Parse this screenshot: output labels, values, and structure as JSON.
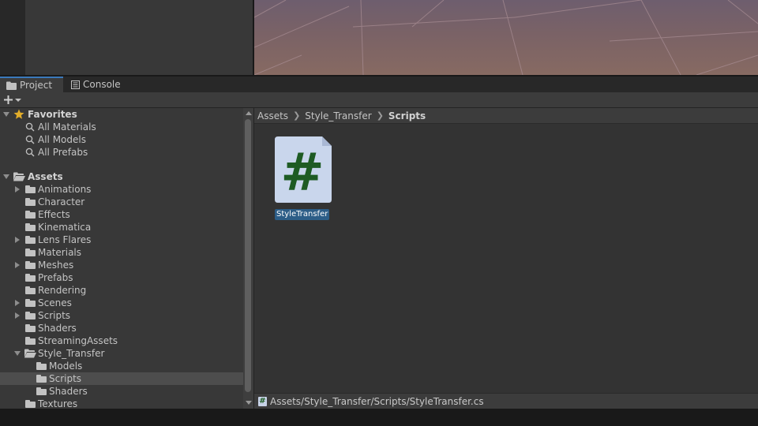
{
  "tabs": {
    "project": {
      "label": "Project",
      "icon": "folder-icon"
    },
    "console": {
      "label": "Console",
      "icon": "console-icon"
    }
  },
  "toolbar": {
    "create_icon": "plus-icon",
    "dropdown_icon": "chevron-down-icon"
  },
  "favorites": {
    "label": "Favorites",
    "items": [
      {
        "label": "All Materials",
        "icon": "search-icon"
      },
      {
        "label": "All Models",
        "icon": "search-icon"
      },
      {
        "label": "All Prefabs",
        "icon": "search-icon"
      }
    ]
  },
  "assets": {
    "label": "Assets",
    "items": [
      {
        "label": "Animations",
        "expandable": true
      },
      {
        "label": "Character",
        "expandable": false
      },
      {
        "label": "Effects",
        "expandable": false
      },
      {
        "label": "Kinematica",
        "expandable": false
      },
      {
        "label": "Lens Flares",
        "expandable": true
      },
      {
        "label": "Materials",
        "expandable": false
      },
      {
        "label": "Meshes",
        "expandable": true
      },
      {
        "label": "Prefabs",
        "expandable": false
      },
      {
        "label": "Rendering",
        "expandable": false
      },
      {
        "label": "Scenes",
        "expandable": true
      },
      {
        "label": "Scripts",
        "expandable": true
      },
      {
        "label": "Shaders",
        "expandable": false
      },
      {
        "label": "StreamingAssets",
        "expandable": false
      },
      {
        "label": "Style_Transfer",
        "expandable": true,
        "expanded": true,
        "children": [
          {
            "label": "Models"
          },
          {
            "label": "Scripts",
            "selected": true
          },
          {
            "label": "Shaders"
          }
        ]
      },
      {
        "label": "Textures",
        "expandable": false
      }
    ]
  },
  "breadcrumb": [
    "Assets",
    "Style_Transfer",
    "Scripts"
  ],
  "asset": {
    "name": "StyleTransfer",
    "icon_glyph": "#",
    "icon": "csharp-script-icon"
  },
  "status": {
    "path": "Assets/Style_Transfer/Scripts/StyleTransfer.cs",
    "icon_glyph": "#"
  },
  "colors": {
    "selection": "#2c5d87",
    "tab_accent": "#3a79bb",
    "script_hash": "#1e5b23"
  }
}
